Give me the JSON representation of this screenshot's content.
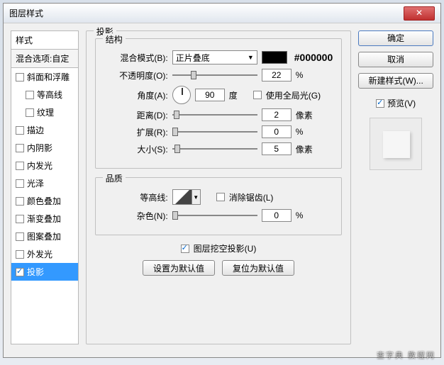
{
  "window": {
    "title": "图层样式"
  },
  "left": {
    "head": "样式",
    "sub": "混合选项:自定",
    "items": [
      {
        "label": "斜面和浮雕",
        "checked": false,
        "indent": false
      },
      {
        "label": "等高线",
        "checked": false,
        "indent": true
      },
      {
        "label": "纹理",
        "checked": false,
        "indent": true
      },
      {
        "label": "描边",
        "checked": false,
        "indent": false
      },
      {
        "label": "内阴影",
        "checked": false,
        "indent": false
      },
      {
        "label": "内发光",
        "checked": false,
        "indent": false
      },
      {
        "label": "光泽",
        "checked": false,
        "indent": false
      },
      {
        "label": "颜色叠加",
        "checked": false,
        "indent": false
      },
      {
        "label": "渐变叠加",
        "checked": false,
        "indent": false
      },
      {
        "label": "图案叠加",
        "checked": false,
        "indent": false
      },
      {
        "label": "外发光",
        "checked": false,
        "indent": false
      },
      {
        "label": "投影",
        "checked": true,
        "indent": false,
        "selected": true
      }
    ]
  },
  "center": {
    "group_main": "投影",
    "group_struct": "结构",
    "blend_label": "混合模式(B):",
    "blend_value": "正片叠底",
    "color_hex": "#000000",
    "opacity_label": "不透明度(O):",
    "opacity_value": "22",
    "pct": "%",
    "angle_label": "角度(A):",
    "angle_value": "90",
    "angle_unit": "度",
    "global_light_label": "使用全局光(G)",
    "global_light_checked": false,
    "distance_label": "距离(D):",
    "distance_value": "2",
    "px": "像素",
    "spread_label": "扩展(R):",
    "spread_value": "0",
    "size_label": "大小(S):",
    "size_value": "5",
    "group_quality": "品质",
    "contour_label": "等高线:",
    "antialias_label": "消除锯齿(L)",
    "antialias_checked": false,
    "noise_label": "杂色(N):",
    "noise_value": "0",
    "knockout_label": "图层挖空投影(U)",
    "knockout_checked": true,
    "btn_default": "设置为默认值",
    "btn_reset": "复位为默认值"
  },
  "right": {
    "ok": "确定",
    "cancel": "取消",
    "new_style": "新建样式(W)...",
    "preview_label": "预览(V)",
    "preview_checked": true
  },
  "watermark": "查字典 教程网"
}
